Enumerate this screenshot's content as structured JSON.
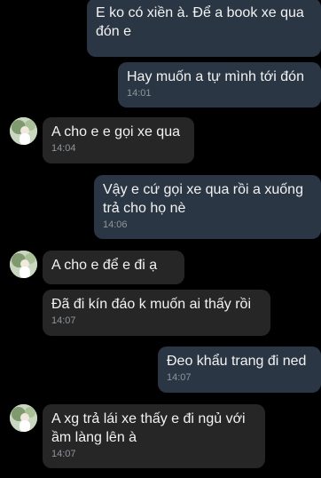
{
  "conversation": {
    "messages": [
      {
        "direction": "out",
        "text": "E ko có xiền à. Để a book xe qua đón e",
        "time": ""
      },
      {
        "direction": "out",
        "text": "Hay muốn a tự mình tới đón",
        "time": "14:01"
      },
      {
        "direction": "in",
        "text": "A cho e e gọi xe qua",
        "time": "14:04"
      },
      {
        "direction": "out",
        "text": "Vậy e cứ gọi xe qua rồi a xuống trả cho họ nè",
        "time": "14:06"
      },
      {
        "direction": "in",
        "text": "A cho e để e đi ạ",
        "time": ""
      },
      {
        "direction": "in",
        "text": "Đã đi kín đáo k muốn ai thấy rồi",
        "time": "14:07"
      },
      {
        "direction": "out",
        "text": "Đeo khẩu trang đi ned",
        "time": "14:07"
      },
      {
        "direction": "in",
        "text": "A xg trả lái xe thấy e đi ngủ với ầm làng lên à",
        "time": "14:07"
      }
    ]
  },
  "colors": {
    "background": "#000000",
    "outgoing_bubble": "#2b3644",
    "incoming_bubble": "#262626",
    "text": "#f2f2f2",
    "timestamp": "#8f959c"
  },
  "icons": {
    "contact_avatar": "avatar-icon"
  }
}
